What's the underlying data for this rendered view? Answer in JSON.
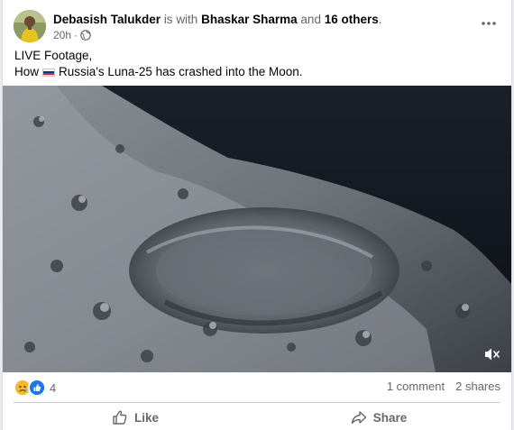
{
  "post": {
    "author_name": "Debasish Talukder",
    "with_text": "is with",
    "tagged_name": "Bhaskar Sharma",
    "and_text": "and",
    "others_text": "16 others",
    "period": ".",
    "timestamp": "20h",
    "separator": "·",
    "audience_icon": "globe-icon",
    "more_icon": "more-horizontal-icon",
    "text_line_1": "LIVE Footage,",
    "text_line_2_prefix": "How",
    "flag_icon": "russia-flag-icon",
    "text_line_2_suffix": "Russia's Luna-25 has crashed into the Moon."
  },
  "video": {
    "content": "moon-surface-video",
    "mute_icon": "muted-speaker-icon"
  },
  "stats": {
    "reaction_icons": [
      "sad-reaction-icon",
      "like-reaction-icon"
    ],
    "reaction_count": "4",
    "comments": "1 comment",
    "shares": "2 shares"
  },
  "actions": {
    "like_label": "Like",
    "share_label": "Share"
  },
  "colors": {
    "text_primary": "#050505",
    "text_secondary": "#65676b",
    "like_blue": "#1877f2",
    "sad_yellow": "#f7b928",
    "divider": "#ced0d4",
    "flag_white": "#ffffff",
    "flag_blue": "#0039a6",
    "flag_red": "#d52b1e"
  }
}
